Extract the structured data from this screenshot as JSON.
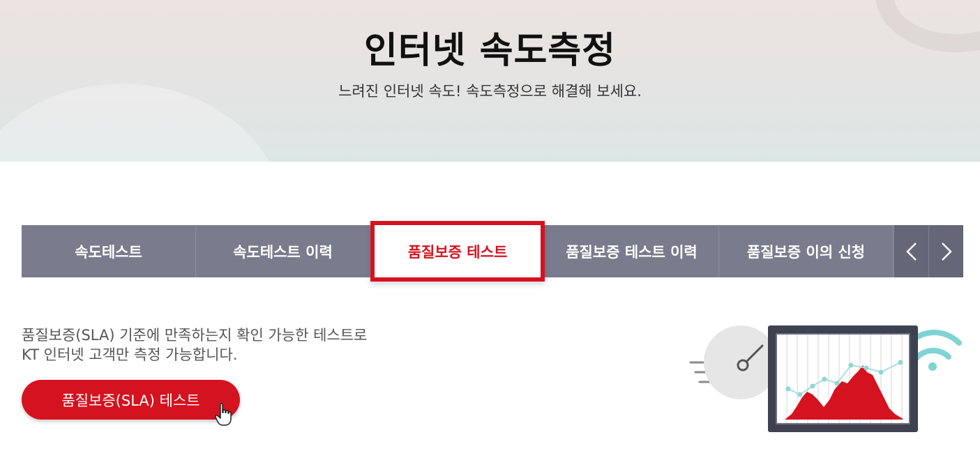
{
  "hero": {
    "title": "인터넷 속도측정",
    "subtitle": "느려진 인터넷 속도! 속도측정으로 해결해 보세요."
  },
  "tabs": [
    {
      "label": "속도테스트",
      "active": false
    },
    {
      "label": "속도테스트 이력",
      "active": false
    },
    {
      "label": "품질보증 테스트",
      "active": true
    },
    {
      "label": "품질보증 테스트 이력",
      "active": false
    },
    {
      "label": "품질보증 이의 신청",
      "active": false
    }
  ],
  "tab_nav": {
    "prev_icon": "chevron-left-icon",
    "next_icon": "chevron-right-icon"
  },
  "content": {
    "description_line1": "품질보증(SLA) 기준에 만족하는지 확인 가능한 테스트로",
    "description_line2": "KT 인터넷 고객만 측정 가능합니다.",
    "button_label": "품질보증(SLA) 테스트"
  },
  "colors": {
    "accent": "#d5121f",
    "tab_bar": "#7a7b8d",
    "tab_arrows": "#656677",
    "wifi": "#7fd3d3"
  }
}
